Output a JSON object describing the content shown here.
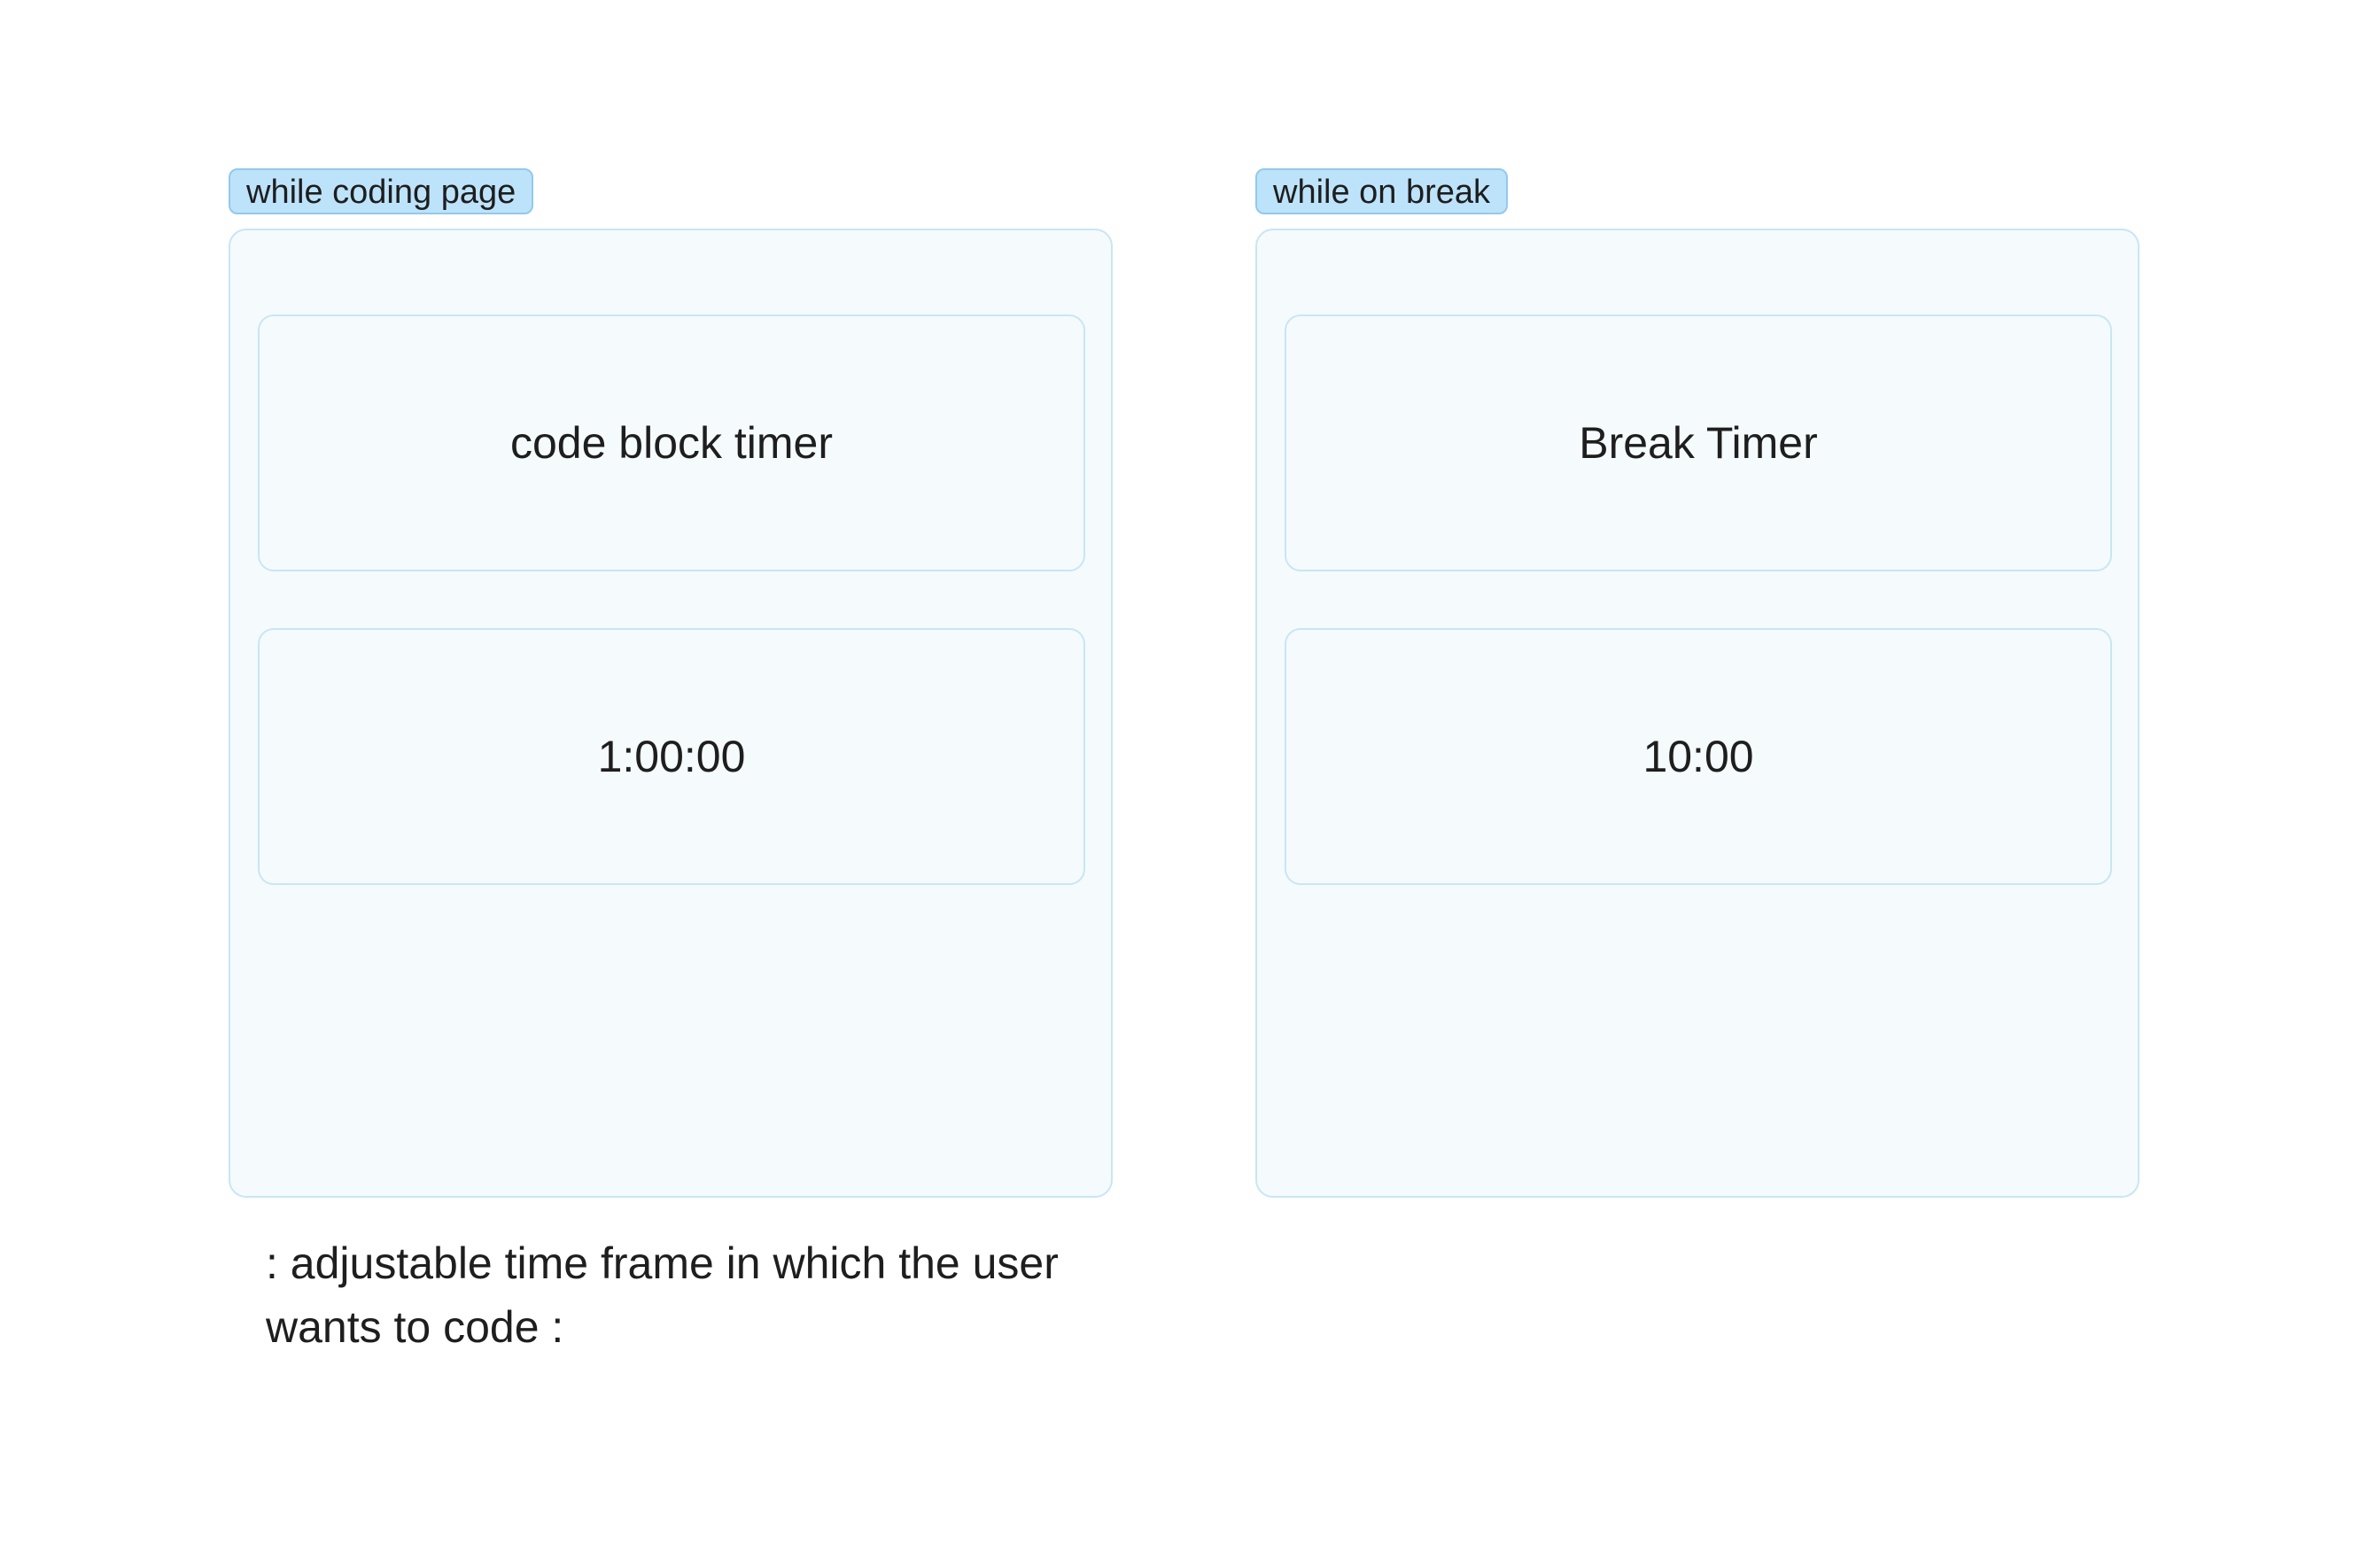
{
  "coding_frame": {
    "tag": "while coding page",
    "title": "code block timer",
    "timer": "1:00:00"
  },
  "break_frame": {
    "tag": "while on break",
    "title": "Break Timer",
    "timer": "10:00"
  },
  "note": {
    "line1": ":  adjustable time frame in which the user",
    "line2": "wants to code :"
  },
  "colors": {
    "tag_fill": "#bde3fb",
    "tag_border": "#93c9ea",
    "frame_fill": "#f5fafd",
    "frame_border": "#c8e6f4",
    "text": "#1e1e1e"
  }
}
